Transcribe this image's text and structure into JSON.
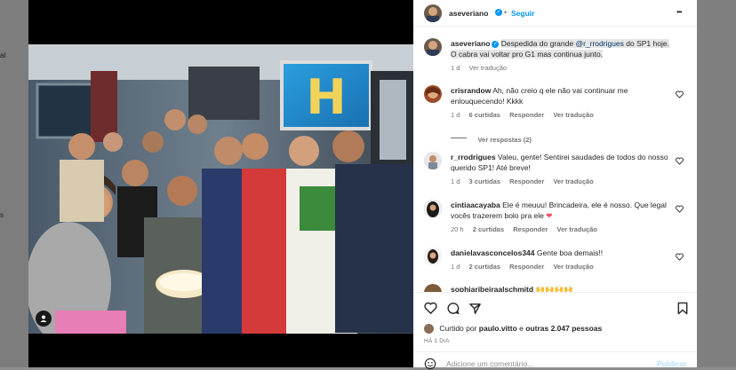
{
  "background_left_glyphs": [
    "al",
    "s"
  ],
  "post": {
    "username": "aseveriano",
    "follow_label": "Seguir",
    "more_label": "•••",
    "caption_before": "Despedida do grande ",
    "caption_mention": "@r_rrodrigues",
    "caption_after": " do SP1 hoje. O cabra vai voltar pro G1 mas continua junto.",
    "caption_time": "1 d",
    "caption_translate": "Ver tradução"
  },
  "comments": [
    {
      "username": "crisrandow",
      "text": "Ah, não creio q ele não vai continuar me enlouquecendo! Kkkk",
      "time": "1 d",
      "likes": "6 curtidas",
      "reply": "Responder",
      "translate": "Ver tradução",
      "view_replies": "Ver respostas (2)"
    },
    {
      "username": "r_rrodrigues",
      "text": "Valeu, gente! Sentirei saudades de todos do nosso querido SP1! Até breve!",
      "time": "1 d",
      "likes": "3 curtidas",
      "reply": "Responder",
      "translate": "Ver tradução"
    },
    {
      "username": "cintiaacayaba",
      "text": "Ele é meuuu! Brincadeira, ele é nosso. Que legal vocês trazerem bolo pra ele",
      "emoji": "❤",
      "time": "20 h",
      "likes": "2 curtidas",
      "reply": "Responder",
      "translate": "Ver tradução"
    },
    {
      "username": "danielavasconcelos344",
      "text": "Gente boa demais!!",
      "time": "1 d",
      "likes": "2 curtidas",
      "reply": "Responder",
      "translate": "Ver tradução"
    },
    {
      "username": "sophiaribeiraalschmitd",
      "text": "🙌🙌🙌🙌"
    }
  ],
  "footer": {
    "liked_prefix": "Curtido por ",
    "liked_user": "paulo.vitto",
    "liked_middle": " e ",
    "liked_others": "outras 2.047 pessoas",
    "timestamp": "HÁ 1 DIA",
    "add_comment_placeholder": "Adicione um comentário...",
    "publish_label": "Publicar"
  },
  "colors": {
    "accent": "#0095f6",
    "heart_red": "#ed4956"
  }
}
